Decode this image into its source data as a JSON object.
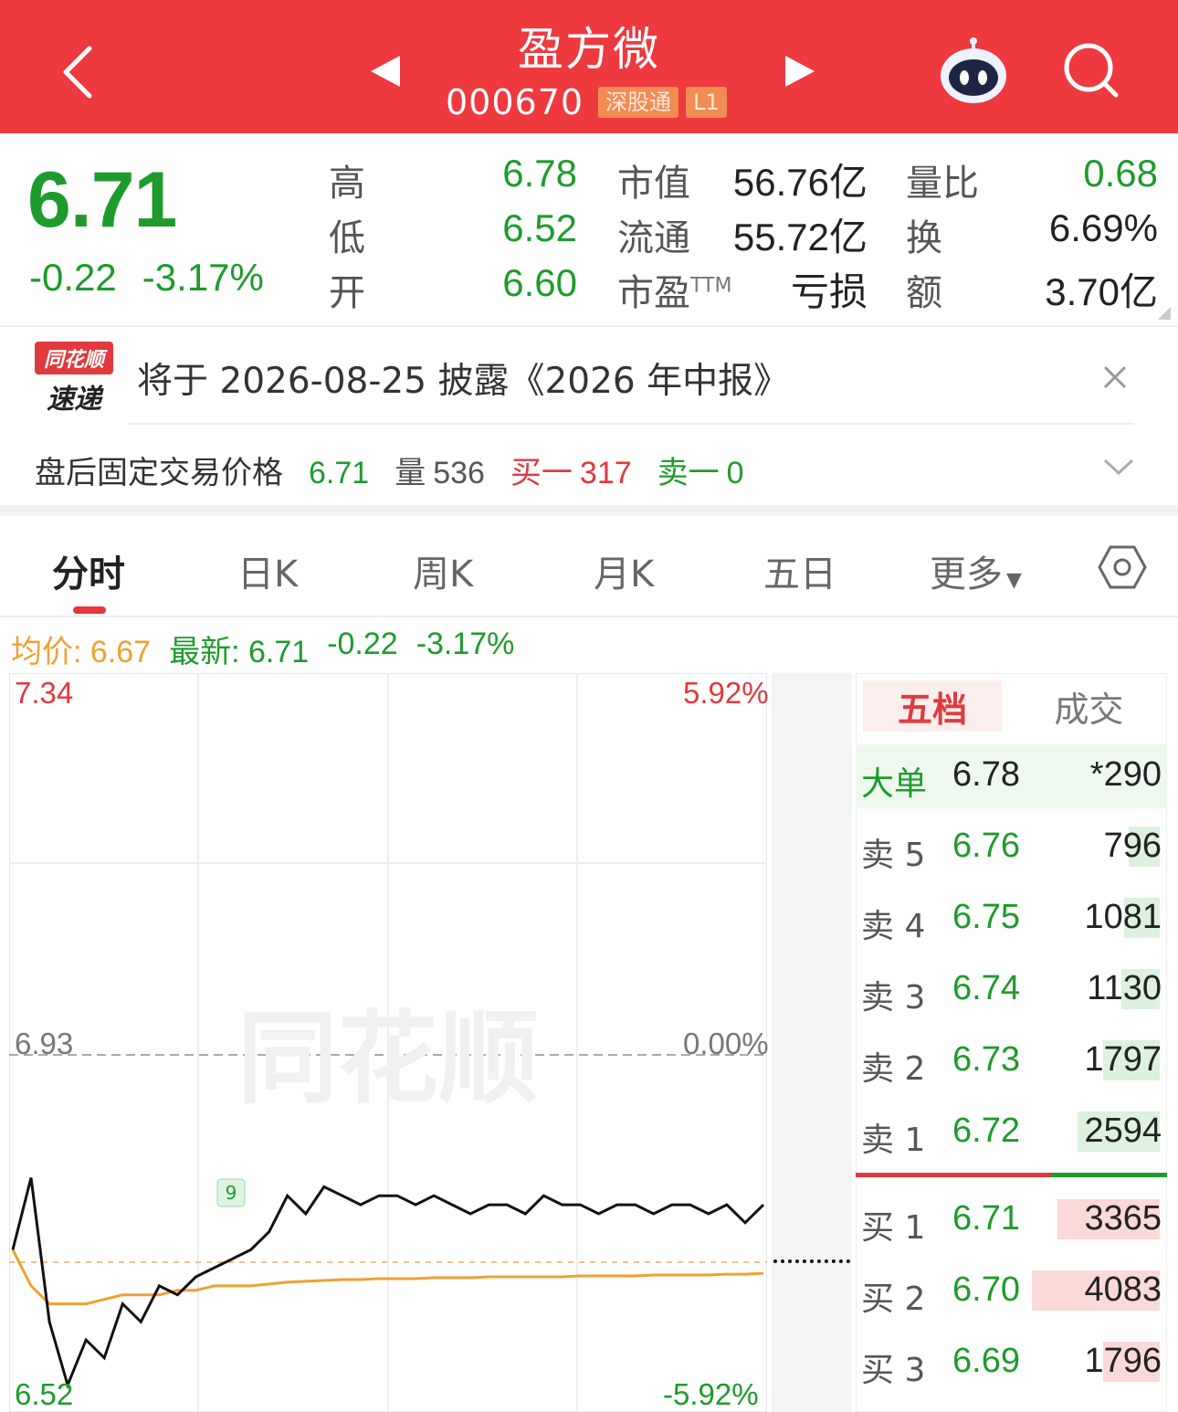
{
  "header": {
    "title": "盈方微",
    "code": "000670",
    "tags": [
      "深股通",
      "L1"
    ]
  },
  "quote": {
    "price": "6.71",
    "change": "-0.22",
    "change_pct": "-3.17%",
    "stats": [
      {
        "label": "高",
        "value": "6.78"
      },
      {
        "label": "低",
        "value": "6.52"
      },
      {
        "label": "开",
        "value": "6.60"
      },
      {
        "label": "市值",
        "value": "56.76亿"
      },
      {
        "label": "流通",
        "value": "55.72亿"
      },
      {
        "label": "市盈",
        "value": "亏损",
        "sup": "TTM"
      },
      {
        "label": "量比",
        "value": "0.68"
      },
      {
        "label": "换",
        "value": "6.69%"
      },
      {
        "label": "额",
        "value": "3.70亿"
      }
    ]
  },
  "notice": {
    "logo_line1": "同花顺",
    "logo_line2": "速递",
    "text": "将于 2026-08-25 披露《2026 年中报》"
  },
  "after_hours": {
    "label": "盘后固定交易价格",
    "price": "6.71",
    "volume_label": "量",
    "volume": "536",
    "bid_label": "买一",
    "bid": "317",
    "ask_label": "卖一",
    "ask": "0"
  },
  "tabs": [
    "分时",
    "日K",
    "周K",
    "月K",
    "五日",
    "更多"
  ],
  "info_line": {
    "avg_label": "均价:",
    "avg": "6.67",
    "latest_label": "最新:",
    "latest": "6.71",
    "change": "-0.22",
    "change_pct": "-3.17%"
  },
  "chart": {
    "y_top": "7.34",
    "y_mid": "6.93",
    "y_bot": "6.52",
    "pct_top": "5.92%",
    "pct_mid": "0.00%",
    "pct_bot": "-5.92%",
    "marker": "9",
    "watermark": "同花顺"
  },
  "chart_data": {
    "type": "line",
    "title": "",
    "ylim": [
      6.52,
      7.34
    ],
    "prev_close": 6.93,
    "series": [
      {
        "name": "最新",
        "values": [
          6.7,
          6.78,
          6.62,
          6.55,
          6.6,
          6.58,
          6.64,
          6.62,
          6.66,
          6.65,
          6.67,
          6.68,
          6.69,
          6.7,
          6.72,
          6.76,
          6.74,
          6.77,
          6.76,
          6.75,
          6.76,
          6.76,
          6.75,
          6.76,
          6.75,
          6.74,
          6.75,
          6.75,
          6.74,
          6.76,
          6.75,
          6.75,
          6.74,
          6.75,
          6.75,
          6.74,
          6.75,
          6.75,
          6.74,
          6.75,
          6.73,
          6.75
        ]
      },
      {
        "name": "均价",
        "values": [
          6.7,
          6.66,
          6.64,
          6.64,
          6.64,
          6.645,
          6.65,
          6.65,
          6.65,
          6.655,
          6.655,
          6.66,
          6.66,
          6.66,
          6.662,
          6.664,
          6.665,
          6.666,
          6.667,
          6.667,
          6.668,
          6.668,
          6.668,
          6.669,
          6.669,
          6.669,
          6.67,
          6.67,
          6.67,
          6.67,
          6.67,
          6.671,
          6.671,
          6.671,
          6.671,
          6.672,
          6.672,
          6.672,
          6.672,
          6.673,
          6.673,
          6.674
        ]
      }
    ]
  },
  "order_book": {
    "tabs": [
      "五档",
      "成交"
    ],
    "rows": [
      {
        "label": "大单",
        "price": "6.78",
        "volume": "*290",
        "side": "big"
      },
      {
        "label": "卖 5",
        "price": "6.76",
        "volume": "796",
        "side": "sell",
        "level": 0.12
      },
      {
        "label": "卖 4",
        "price": "6.75",
        "volume": "1081",
        "side": "sell",
        "level": 0.14
      },
      {
        "label": "卖 3",
        "price": "6.74",
        "volume": "1130",
        "side": "sell",
        "level": 0.15
      },
      {
        "label": "卖 2",
        "price": "6.73",
        "volume": "1797",
        "side": "sell",
        "level": 0.22
      },
      {
        "label": "卖 1",
        "price": "6.72",
        "volume": "2594",
        "side": "sell",
        "level": 0.32
      },
      {
        "label": "买 1",
        "price": "6.71",
        "volume": "3365",
        "side": "buy",
        "level": 0.4
      },
      {
        "label": "买 2",
        "price": "6.70",
        "volume": "4083",
        "side": "buy",
        "level": 0.5
      },
      {
        "label": "买 3",
        "price": "6.69",
        "volume": "1796",
        "side": "buy",
        "level": 0.22
      }
    ]
  },
  "colors": {
    "header_red": "#ee3a3f",
    "up_red": "#e03a3e",
    "down_green": "#1e9b2c",
    "avg_orange": "#f0a030"
  }
}
